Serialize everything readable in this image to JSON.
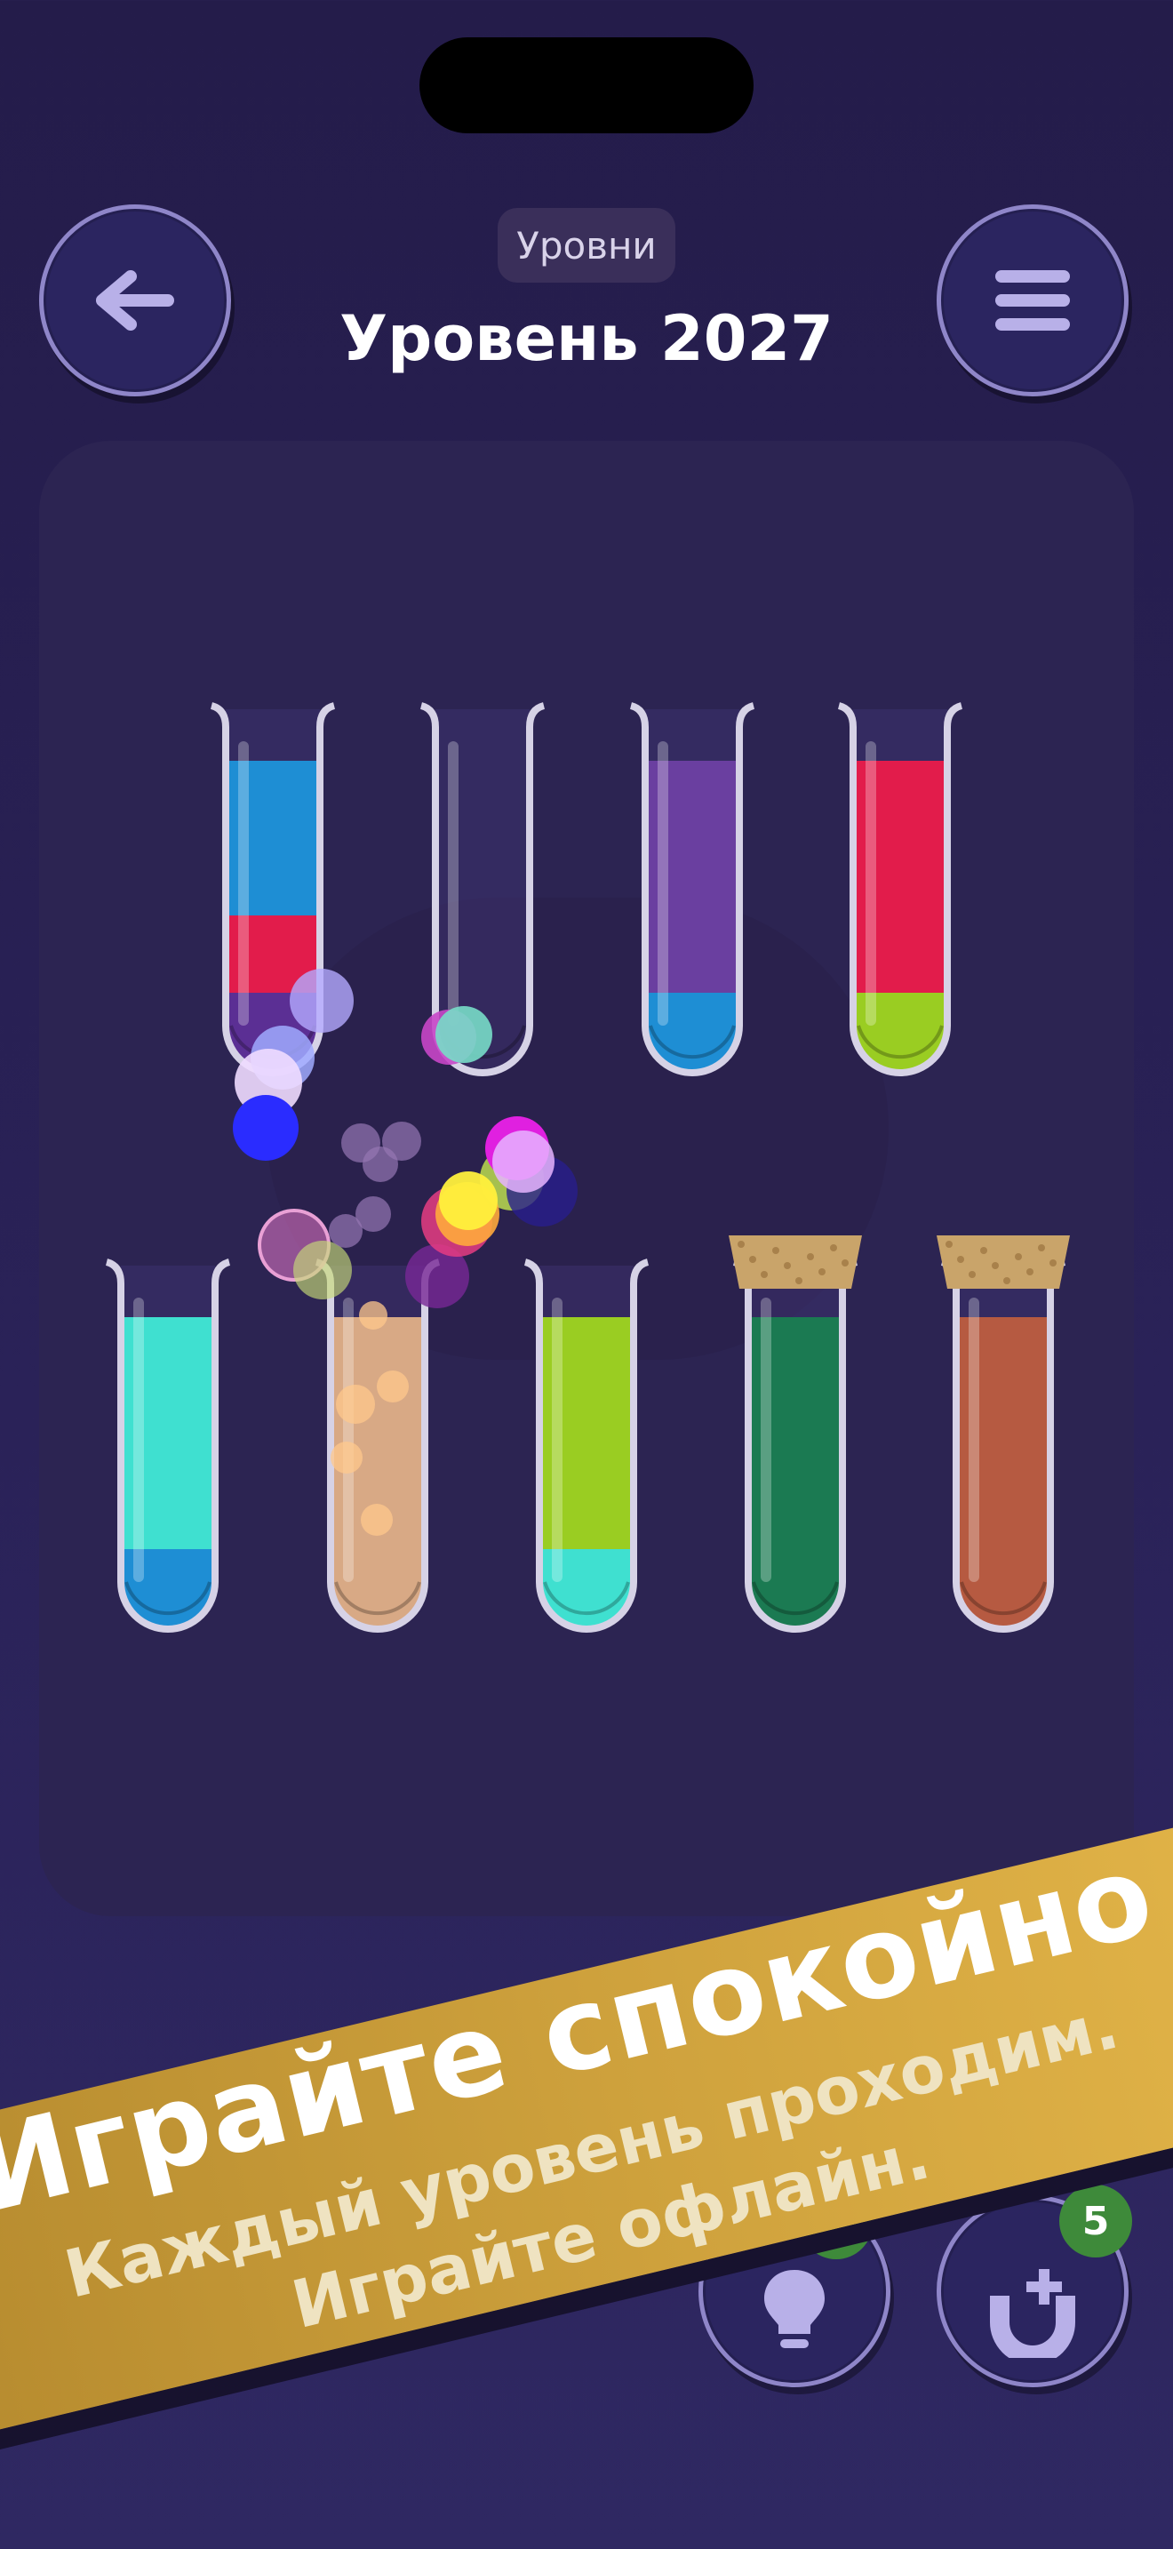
{
  "header": {
    "levels_label": "Уровни",
    "level_title": "Уровень 2027"
  },
  "tubes_row1": [
    {
      "name": "tube-1",
      "layers": [
        "#1e8ed4",
        "#1e8ed4",
        "#e21c4b",
        "#5b2f94"
      ],
      "corked": false
    },
    {
      "name": "tube-2",
      "layers": [],
      "corked": false
    },
    {
      "name": "tube-3",
      "layers": [
        "#6a3fa0",
        "#6a3fa0",
        "#6a3fa0",
        "#1e8ed4"
      ],
      "corked": false
    },
    {
      "name": "tube-4",
      "layers": [
        "#e21c4b",
        "#e21c4b",
        "#e21c4b",
        "#9acd22"
      ],
      "corked": false
    }
  ],
  "tubes_row2": [
    {
      "name": "tube-5",
      "layers": [
        "#3fe0d0",
        "#3fe0d0",
        "#3fe0d0",
        "#1e8ed4"
      ],
      "corked": false
    },
    {
      "name": "tube-6",
      "layers": [
        "#d8a985",
        "#d8a985",
        "#d8a985",
        "#d8a985"
      ],
      "corked": false
    },
    {
      "name": "tube-7",
      "layers": [
        "#9acd22",
        "#9acd22",
        "#9acd22",
        "#3fe0d0"
      ],
      "corked": false
    },
    {
      "name": "tube-8",
      "layers": [
        "#1b7a52",
        "#1b7a52",
        "#1b7a52",
        "#1b7a52"
      ],
      "corked": true
    },
    {
      "name": "tube-9",
      "layers": [
        "#b65a41",
        "#b65a41",
        "#b65a41",
        "#b65a41"
      ],
      "corked": true
    }
  ],
  "banner": {
    "title": "Играйте спокойно",
    "subtitle_line1": "Каждый уровень проходим.",
    "subtitle_line2": "Играйте офлайн."
  },
  "boosters": {
    "magnet_count": "5"
  },
  "colors": {
    "background": "#241c4a",
    "button_border": "#8f86c9",
    "banner": "#cfa23d"
  }
}
